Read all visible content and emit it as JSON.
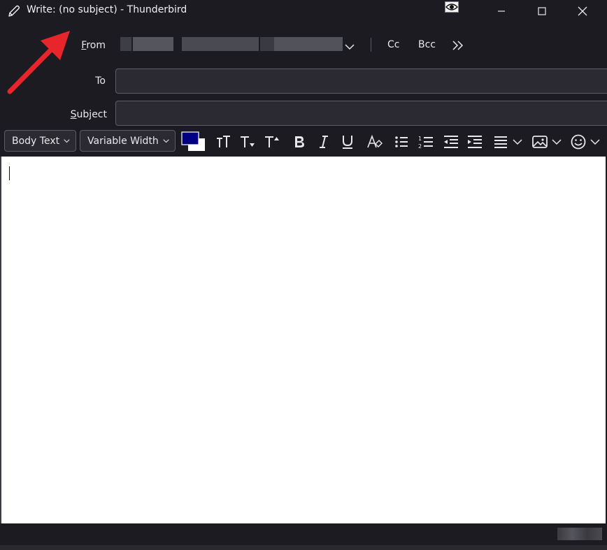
{
  "window": {
    "title": "Write: (no subject) - Thunderbird",
    "title_icon": "pencil-icon",
    "eye_icon": "eye-icon",
    "controls": [
      "minimize-icon",
      "maximize-icon",
      "close-icon"
    ]
  },
  "header": {
    "from_label": "From",
    "from_value_redacted": true,
    "cc_label": "Cc",
    "bcc_label": "Bcc",
    "more_icon": "double-chevron-right-icon",
    "to_label": "To",
    "to_value": "",
    "subject_label": "Subject",
    "subject_value": ""
  },
  "toolbar": {
    "paragraph_format": "Body Text",
    "font": "Variable Width",
    "text_color": "#000080",
    "background_color": "#ffffff",
    "icons": [
      "font-size-reset-icon",
      "decrease-font-size-icon",
      "increase-font-size-icon",
      "bold-icon",
      "italic-icon",
      "underline-icon",
      "clear-formatting-icon",
      "bulleted-list-icon",
      "numbered-list-icon",
      "outdent-icon",
      "indent-icon",
      "align-icon",
      "insert-image-icon",
      "emoji-icon"
    ]
  },
  "body": {
    "content": ""
  },
  "colors": {
    "chrome_bg": "#1c1b22",
    "field_bg": "#2b2a33",
    "field_border": "#5c5c66",
    "annotation_arrow": "#e8252b"
  }
}
